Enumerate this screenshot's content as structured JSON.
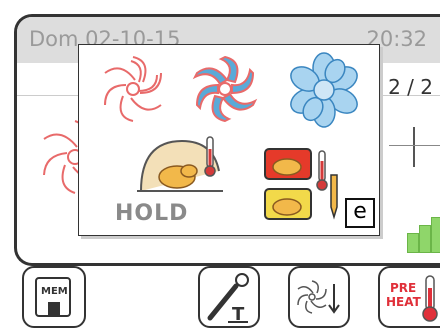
{
  "status_bar": {
    "date": "Dom 02-10-15",
    "time": "20:32"
  },
  "page_indicator": "2 / 2",
  "popup": {
    "options": [
      {
        "name": "fan-speed-1",
        "icon": "fan-icon"
      },
      {
        "name": "fan-speed-2",
        "icon": "fan-icon"
      },
      {
        "name": "fan-speed-3",
        "icon": "fan-icon"
      },
      {
        "name": "hold",
        "label": "HOLD",
        "icon": "roast-chicken-hold-icon"
      },
      {
        "name": "probe-cooking",
        "icon": "roast-chicken-thermometer-icon"
      }
    ],
    "selected_marker": "e"
  },
  "toolbar": {
    "mem_label": "MEM",
    "preheat_line1": "PRE",
    "preheat_line2": "HEAT",
    "buttons": [
      "memory-button",
      "core-probe-button",
      "fan-temperature-button",
      "preheat-button"
    ]
  },
  "colors": {
    "fan_red": "#e86a6a",
    "fan_blue": "#5aaad8",
    "accent_green": "#8fd66a",
    "hold_text": "#8a8a8a"
  }
}
